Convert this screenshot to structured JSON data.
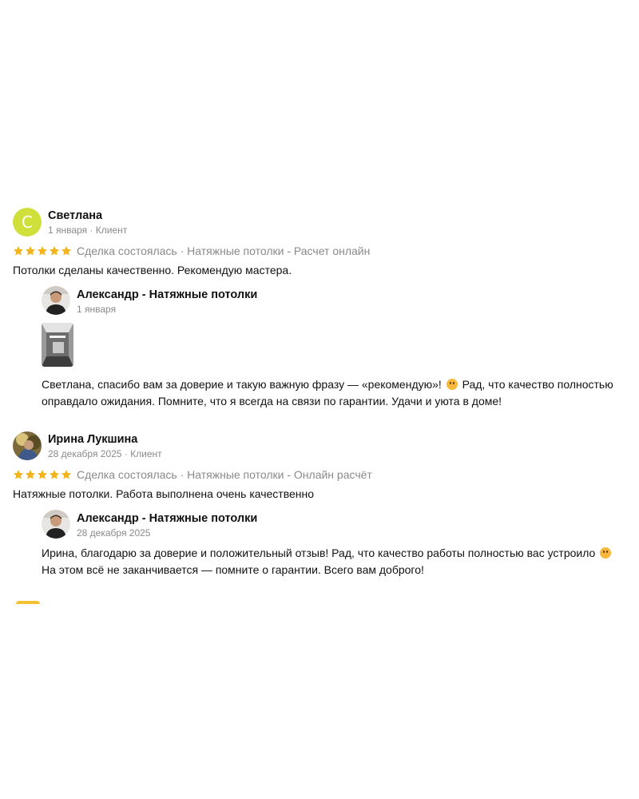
{
  "colors": {
    "star": "#f2b61c",
    "meta": "#8a8a8a",
    "avatar_letter_bg": "#cfe03a"
  },
  "reviews": [
    {
      "avatar_letter": "С",
      "author": "Светлана",
      "meta": "1 января · Клиент",
      "rating": 5,
      "deal": "Сделка состоялась · Натяжные потолки - Расчет онлайн",
      "text": "Потолки сделаны качественно. Рекомендую мастера.",
      "reply": {
        "author": "Александр - Натяжные потолки",
        "date": "1 января",
        "line1_a": "Светлана, спасибо вам за доверие и такую важную фразу — «рекомендую»!",
        "line1_b": "Рад, что качество полностью",
        "line2": "оправдало ожидания. Помните, что я всегда на связи по гарантии. Удачи и уюта в доме!"
      }
    },
    {
      "author": "Ирина Лукшина",
      "meta": "28 декабря 2025 · Клиент",
      "rating": 5,
      "deal": "Сделка состоялась · Натяжные потолки - Онлайн расчёт",
      "text": "Натяжные потолки. Работа выполнена очень качественно",
      "reply": {
        "author": "Александр - Натяжные потолки",
        "date": "28 декабря 2025",
        "line1": "Ирина, благодарю за доверие и положительный отзыв! Рад, что качество работы полностью вас устроило",
        "line2": "На этом всё не заканчивается — помните о гарантии. Всего вам доброго!"
      }
    }
  ]
}
